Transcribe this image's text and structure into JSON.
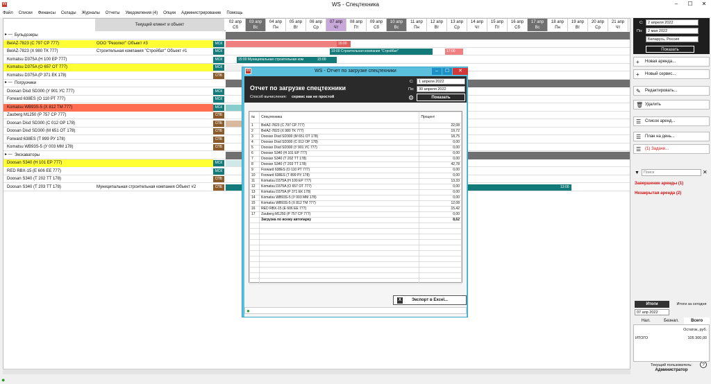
{
  "window": {
    "title": "WS - Спецтехника"
  },
  "menu": [
    "Файл",
    "Списки",
    "Финансы",
    "Склады",
    "Журналы",
    "Отчеты",
    "Уведомления (4)",
    "Опции",
    "Администрирование",
    "Помощь"
  ],
  "grid": {
    "header_client": "Текущий клиент и объект",
    "dates": [
      {
        "d": "02 апр",
        "w": "Сб",
        "k": "n"
      },
      {
        "d": "03 апр",
        "w": "Вс",
        "k": "we"
      },
      {
        "d": "04 апр",
        "w": "Пн",
        "k": "n"
      },
      {
        "d": "05 апр",
        "w": "Вт",
        "k": "n"
      },
      {
        "d": "06 апр",
        "w": "Ср",
        "k": "n"
      },
      {
        "d": "07 апр",
        "w": "Чт",
        "k": "today"
      },
      {
        "d": "08 апр",
        "w": "Пт",
        "k": "n"
      },
      {
        "d": "09 апр",
        "w": "Сб",
        "k": "n"
      },
      {
        "d": "10 апр",
        "w": "Вс",
        "k": "we"
      },
      {
        "d": "11 апр",
        "w": "Пн",
        "k": "n"
      },
      {
        "d": "12 апр",
        "w": "Вт",
        "k": "n"
      },
      {
        "d": "13 апр",
        "w": "Ср",
        "k": "n"
      },
      {
        "d": "14 апр",
        "w": "Чт",
        "k": "n"
      },
      {
        "d": "15 апр",
        "w": "Пт",
        "k": "n"
      },
      {
        "d": "16 апр",
        "w": "Сб",
        "k": "n"
      },
      {
        "d": "17 апр",
        "w": "Вс",
        "k": "we"
      },
      {
        "d": "18 апр",
        "w": "Пн",
        "k": "n"
      },
      {
        "d": "19 апр",
        "w": "Вт",
        "k": "n"
      },
      {
        "d": "20 апр",
        "w": "Ср",
        "k": "n"
      },
      {
        "d": "21 апр",
        "w": "Чт",
        "k": "n"
      }
    ],
    "rows": [
      {
        "type": "grp",
        "name": "Бульдозеры"
      },
      {
        "type": "yellow",
        "name": "BelAZ-7823 (С 797 СР 777)",
        "client": "ООО \"Резолют\"   Объект #3",
        "tag": "МСК"
      },
      {
        "type": "n",
        "name": "BelAZ-7823 (Х 980 ТК 777)",
        "client": "Строительная компания \"Стройбат\"   Объект #1",
        "tag": "МСК"
      },
      {
        "type": "n",
        "name": "Komatsu D375A (Н 100 ЕР 777)",
        "client": "",
        "tag": "МСК"
      },
      {
        "type": "yellow",
        "name": "Komatsu D375A (О 657 ОТ 777)",
        "client": "",
        "tag": "МСК"
      },
      {
        "type": "n",
        "name": "Komatsu D375A (Р 371 ЕК 178)",
        "client": "",
        "tag": "СПБ"
      },
      {
        "type": "grp",
        "name": "Погрузчики"
      },
      {
        "type": "n",
        "name": "Doosan Disd SD300 (У 901 УС 777)",
        "client": "",
        "tag": "МСК"
      },
      {
        "type": "n",
        "name": "Forward 638ES (О 110 РТ 777)",
        "client": "",
        "tag": "МСК"
      },
      {
        "type": "red",
        "name": "Komatsu WB93S-5 (Х 812 ТМ 777)",
        "client": "",
        "tag": "МСК"
      },
      {
        "type": "n",
        "name": "Zauberg M1250 (Р 757 СР 777)",
        "client": "",
        "tag": "СПБ"
      },
      {
        "type": "n",
        "name": "Doosan Disd SD300 (С 012 ОР 178)",
        "client": "",
        "tag": "СПБ"
      },
      {
        "type": "n",
        "name": "Doosan Disd SD300 (М 651 ОТ 178)",
        "client": "",
        "tag": "СПБ"
      },
      {
        "type": "n",
        "name": "Forward 638ES (Т 899 РУ 178)",
        "client": "",
        "tag": "СПБ"
      },
      {
        "type": "n",
        "name": "Komatsu WB93S-5 (У 003 ММ 178)",
        "client": "",
        "tag": "СПБ"
      },
      {
        "type": "grp",
        "name": "Экскаваторы"
      },
      {
        "type": "yellow",
        "name": "Doosan S340 (Н 101 ЕР 777)",
        "client": "",
        "tag": "МСК"
      },
      {
        "type": "n",
        "name": "RED RBX-15 (Е 606 ЕЕ 777)",
        "client": "",
        "tag": "МСК"
      },
      {
        "type": "n",
        "name": "Doosan S340 (Т 202 ТТ 178)",
        "client": "",
        "tag": "СПБ"
      },
      {
        "type": "n",
        "name": "Doosan S340 (Т 203 ТТ 178)",
        "client": "Муниципальная строительная компания   Объект #2",
        "tag": "СПБ"
      }
    ],
    "bar_labels": {
      "b1": "15:00",
      "b2": "19:00 Строительная компания \"Стройбат\"",
      "b3": "17:00",
      "b4": "15:00 Муниципальная строительная ком",
      "b4b": "15:00",
      "b5": "13:00",
      "b6": "13:00"
    }
  },
  "modal": {
    "title": "WS - Отчет по загрузке спецтехники",
    "heading": "Отчет по загрузке спецтехники",
    "method_label": "Способ вычисления:",
    "method_value": "сервис как не простой",
    "from_label": "С:",
    "from_value": "1   апреля   2022",
    "to_label": "По:",
    "to_value": "30  апреля   2022",
    "show_btn": "Показать",
    "col_no": "№",
    "col_tech": "Спецтехника",
    "col_pct": "Процент",
    "rows": [
      [
        "1",
        "BelAZ-7823 (С 797 СР 777)",
        "22,08"
      ],
      [
        "2",
        "BelAZ-7823 (Х 980 ТК 777)",
        "19,72"
      ],
      [
        "3",
        "Doosan Disd SD300 (М 651 ОТ 178)",
        "18,75"
      ],
      [
        "4",
        "Doosan Disd SD300 (С 012 ОР 178)",
        "0,00"
      ],
      [
        "5",
        "Doosan Disd SD300 (У 901 УС 777)",
        "0,00"
      ],
      [
        "6",
        "Doosan S340 (Н 101 ЕР 777)",
        "0,00"
      ],
      [
        "7",
        "Doosan S340 (Т 202 ТТ 178)",
        "0,00"
      ],
      [
        "8",
        "Doosan S340 (Т 203 ТТ 178)",
        "42,78"
      ],
      [
        "9",
        "Forward 638ES (О 110 РТ 777)",
        "0,00"
      ],
      [
        "10",
        "Forward 638ES (Т 899 РУ 178)",
        "0,00"
      ],
      [
        "11",
        "Komatsu D375A (Н 100 ЕР 777)",
        "13,33"
      ],
      [
        "12",
        "Komatsu D375A (О 657 ОТ 777)",
        "0,00"
      ],
      [
        "13",
        "Komatsu D375A (Р 371 ЕК 178)",
        "0,00"
      ],
      [
        "14",
        "Komatsu WB93S-5 (У 003 ММ 178)",
        "0,00"
      ],
      [
        "15",
        "Komatsu WB93S-5 (Х 812 ТМ 777)",
        "12,08"
      ],
      [
        "16",
        "RED RBX-15 (Е 606 ЕЕ 777)",
        "15,42"
      ],
      [
        "17",
        "Zauberg M1250 (Р 757 СР 777)",
        "0,00"
      ]
    ],
    "total_label": "Загрузка по всему автопарку",
    "total_value": "8,62",
    "export_btn": "Экспорт в Excel..."
  },
  "panel": {
    "from_label": "С:",
    "from_value": "2  апреля  2022",
    "to_label": "По:",
    "to_value": "2   мая   2022",
    "region": "Беларусь, Россия",
    "show_btn": "Показать",
    "buttons": [
      "Новая аренда...",
      "Новый сервис...",
      "Редактировать...",
      "Удалить",
      "Список аренд...",
      "План на день...",
      "(1) Задачи..."
    ],
    "search_placeholder": "Поиск",
    "alerts": [
      "Завершение аренды (1)",
      "Незакрытая аренда (2)"
    ],
    "totals_tab": "Итоги",
    "totals_today": "Итоги за сегодня",
    "totals_date": "07 апр  2022",
    "pay_tabs": [
      "Нал.",
      "Безнал.",
      "Всего"
    ],
    "balance_label": "Остаток, руб.",
    "total_row_label": "ИТОГО",
    "total_row_value": "105 300,00",
    "user_label": "Текущий пользователь:",
    "user_name": "Администратор"
  },
  "colors": {
    "accent": "#127a78",
    "spb": "#8a5a2a",
    "yellow": "#ffff33",
    "red": "#ff6e50",
    "modal": "#5bc0de"
  }
}
